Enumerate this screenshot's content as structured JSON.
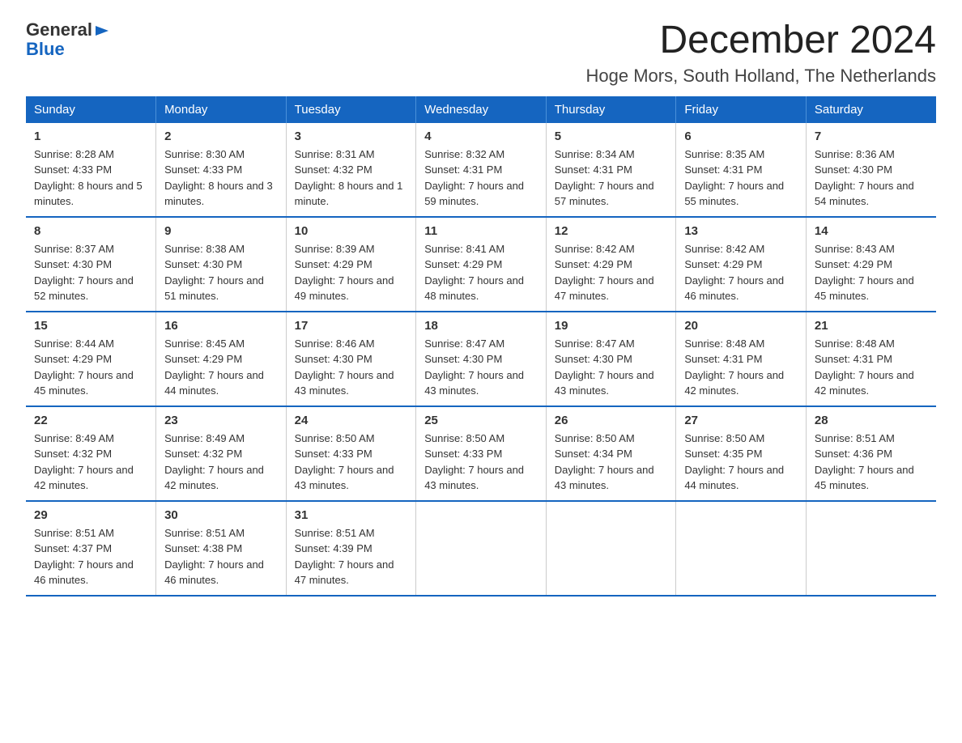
{
  "logo": {
    "part1": "General",
    "part2": "Blue"
  },
  "header": {
    "title": "December 2024",
    "subtitle": "Hoge Mors, South Holland, The Netherlands"
  },
  "weekdays": [
    "Sunday",
    "Monday",
    "Tuesday",
    "Wednesday",
    "Thursday",
    "Friday",
    "Saturday"
  ],
  "weeks": [
    [
      {
        "day": "1",
        "sunrise": "8:28 AM",
        "sunset": "4:33 PM",
        "daylight": "8 hours and 5 minutes."
      },
      {
        "day": "2",
        "sunrise": "8:30 AM",
        "sunset": "4:33 PM",
        "daylight": "8 hours and 3 minutes."
      },
      {
        "day": "3",
        "sunrise": "8:31 AM",
        "sunset": "4:32 PM",
        "daylight": "8 hours and 1 minute."
      },
      {
        "day": "4",
        "sunrise": "8:32 AM",
        "sunset": "4:31 PM",
        "daylight": "7 hours and 59 minutes."
      },
      {
        "day": "5",
        "sunrise": "8:34 AM",
        "sunset": "4:31 PM",
        "daylight": "7 hours and 57 minutes."
      },
      {
        "day": "6",
        "sunrise": "8:35 AM",
        "sunset": "4:31 PM",
        "daylight": "7 hours and 55 minutes."
      },
      {
        "day": "7",
        "sunrise": "8:36 AM",
        "sunset": "4:30 PM",
        "daylight": "7 hours and 54 minutes."
      }
    ],
    [
      {
        "day": "8",
        "sunrise": "8:37 AM",
        "sunset": "4:30 PM",
        "daylight": "7 hours and 52 minutes."
      },
      {
        "day": "9",
        "sunrise": "8:38 AM",
        "sunset": "4:30 PM",
        "daylight": "7 hours and 51 minutes."
      },
      {
        "day": "10",
        "sunrise": "8:39 AM",
        "sunset": "4:29 PM",
        "daylight": "7 hours and 49 minutes."
      },
      {
        "day": "11",
        "sunrise": "8:41 AM",
        "sunset": "4:29 PM",
        "daylight": "7 hours and 48 minutes."
      },
      {
        "day": "12",
        "sunrise": "8:42 AM",
        "sunset": "4:29 PM",
        "daylight": "7 hours and 47 minutes."
      },
      {
        "day": "13",
        "sunrise": "8:42 AM",
        "sunset": "4:29 PM",
        "daylight": "7 hours and 46 minutes."
      },
      {
        "day": "14",
        "sunrise": "8:43 AM",
        "sunset": "4:29 PM",
        "daylight": "7 hours and 45 minutes."
      }
    ],
    [
      {
        "day": "15",
        "sunrise": "8:44 AM",
        "sunset": "4:29 PM",
        "daylight": "7 hours and 45 minutes."
      },
      {
        "day": "16",
        "sunrise": "8:45 AM",
        "sunset": "4:29 PM",
        "daylight": "7 hours and 44 minutes."
      },
      {
        "day": "17",
        "sunrise": "8:46 AM",
        "sunset": "4:30 PM",
        "daylight": "7 hours and 43 minutes."
      },
      {
        "day": "18",
        "sunrise": "8:47 AM",
        "sunset": "4:30 PM",
        "daylight": "7 hours and 43 minutes."
      },
      {
        "day": "19",
        "sunrise": "8:47 AM",
        "sunset": "4:30 PM",
        "daylight": "7 hours and 43 minutes."
      },
      {
        "day": "20",
        "sunrise": "8:48 AM",
        "sunset": "4:31 PM",
        "daylight": "7 hours and 42 minutes."
      },
      {
        "day": "21",
        "sunrise": "8:48 AM",
        "sunset": "4:31 PM",
        "daylight": "7 hours and 42 minutes."
      }
    ],
    [
      {
        "day": "22",
        "sunrise": "8:49 AM",
        "sunset": "4:32 PM",
        "daylight": "7 hours and 42 minutes."
      },
      {
        "day": "23",
        "sunrise": "8:49 AM",
        "sunset": "4:32 PM",
        "daylight": "7 hours and 42 minutes."
      },
      {
        "day": "24",
        "sunrise": "8:50 AM",
        "sunset": "4:33 PM",
        "daylight": "7 hours and 43 minutes."
      },
      {
        "day": "25",
        "sunrise": "8:50 AM",
        "sunset": "4:33 PM",
        "daylight": "7 hours and 43 minutes."
      },
      {
        "day": "26",
        "sunrise": "8:50 AM",
        "sunset": "4:34 PM",
        "daylight": "7 hours and 43 minutes."
      },
      {
        "day": "27",
        "sunrise": "8:50 AM",
        "sunset": "4:35 PM",
        "daylight": "7 hours and 44 minutes."
      },
      {
        "day": "28",
        "sunrise": "8:51 AM",
        "sunset": "4:36 PM",
        "daylight": "7 hours and 45 minutes."
      }
    ],
    [
      {
        "day": "29",
        "sunrise": "8:51 AM",
        "sunset": "4:37 PM",
        "daylight": "7 hours and 46 minutes."
      },
      {
        "day": "30",
        "sunrise": "8:51 AM",
        "sunset": "4:38 PM",
        "daylight": "7 hours and 46 minutes."
      },
      {
        "day": "31",
        "sunrise": "8:51 AM",
        "sunset": "4:39 PM",
        "daylight": "7 hours and 47 minutes."
      },
      null,
      null,
      null,
      null
    ]
  ]
}
